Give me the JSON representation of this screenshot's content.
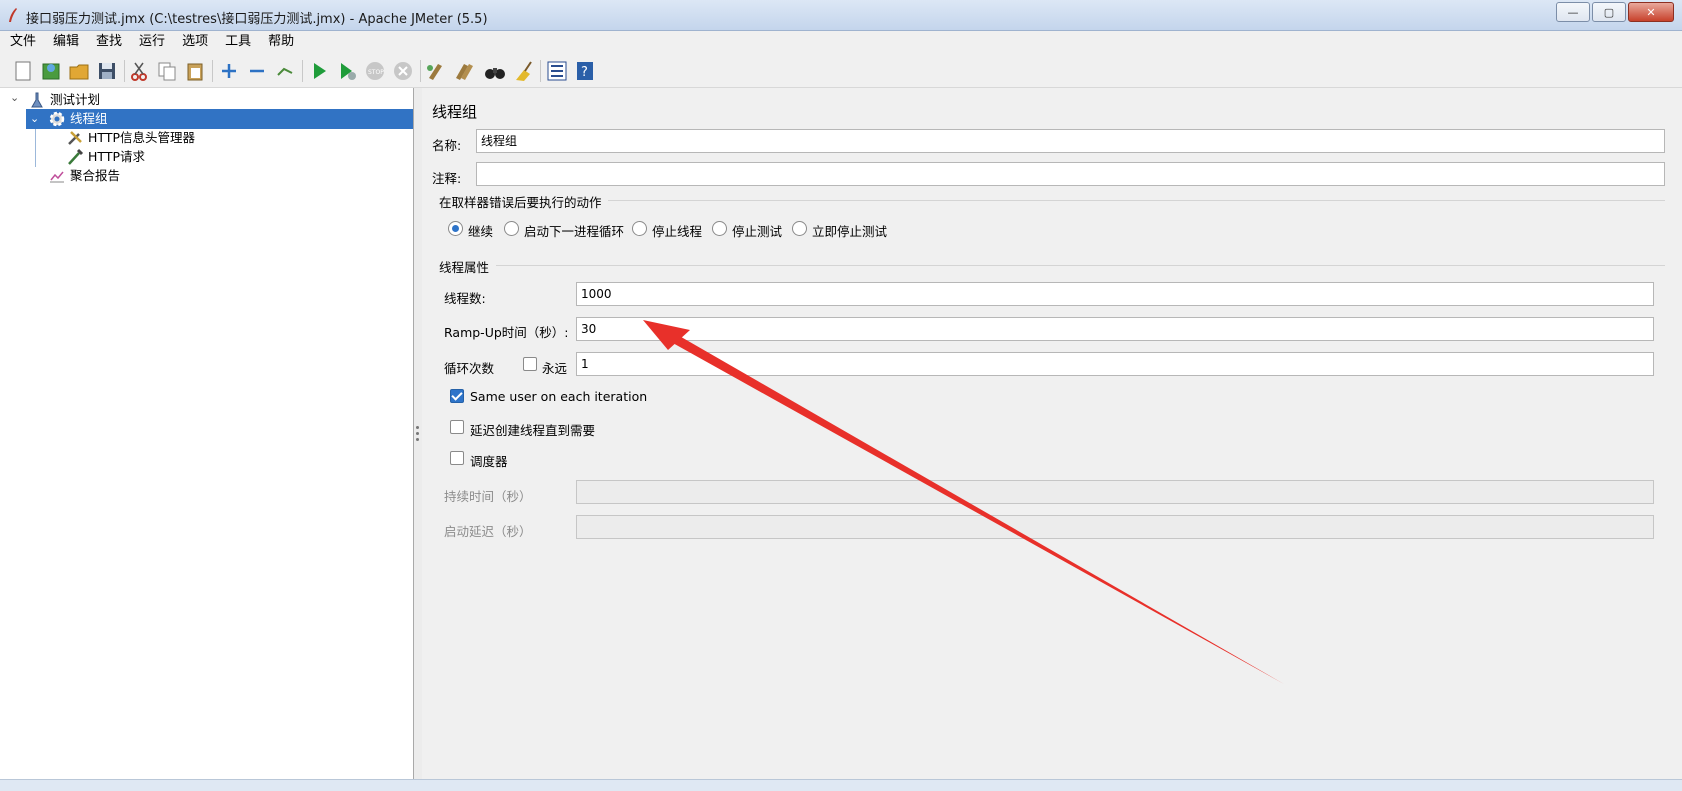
{
  "window": {
    "title": "接口弱压力测试.jmx (C:\\testres\\接口弱压力测试.jmx) - Apache JMeter (5.5)",
    "minimize": "—",
    "maximize": "▢",
    "close": "✕"
  },
  "menu": [
    "文件",
    "编辑",
    "查找",
    "运行",
    "选项",
    "工具",
    "帮助"
  ],
  "tree": {
    "items": [
      {
        "label": "测试计划",
        "icon": "test-plan-icon"
      },
      {
        "label": "线程组",
        "icon": "gear-icon",
        "selected": true
      },
      {
        "label": "HTTP信息头管理器",
        "icon": "wrench-icon"
      },
      {
        "label": "HTTP请求",
        "icon": "pipette-icon"
      },
      {
        "label": "聚合报告",
        "icon": "chart-icon"
      }
    ]
  },
  "thread_group": {
    "title": "线程组",
    "name_label": "名称:",
    "name_value": "线程组",
    "comment_label": "注释:",
    "comment_value": "",
    "on_error": {
      "header": "在取样器错误后要执行的动作",
      "options": [
        "继续",
        "启动下一进程循环",
        "停止线程",
        "停止测试",
        "立即停止测试"
      ],
      "selected": "继续"
    },
    "props": {
      "header": "线程属性",
      "threads_label": "线程数:",
      "threads_value": "1000",
      "rampup_label": "Ramp-Up时间（秒）:",
      "rampup_value": "30",
      "loop_label": "循环次数",
      "forever_label": "永远",
      "forever_checked": false,
      "loop_value": "1",
      "same_user_label": "Same user on each iteration",
      "same_user_checked": true,
      "delay_label": "延迟创建线程直到需要",
      "delay_checked": false,
      "scheduler_label": "调度器",
      "scheduler_checked": false,
      "duration_label": "持续时间（秒）",
      "duration_value": "",
      "startup_delay_label": "启动延迟（秒）",
      "startup_delay_value": ""
    }
  },
  "colors": {
    "selection": "#3173c4",
    "accent": "#2e74c9",
    "annotation_arrow": "#e8302a"
  }
}
